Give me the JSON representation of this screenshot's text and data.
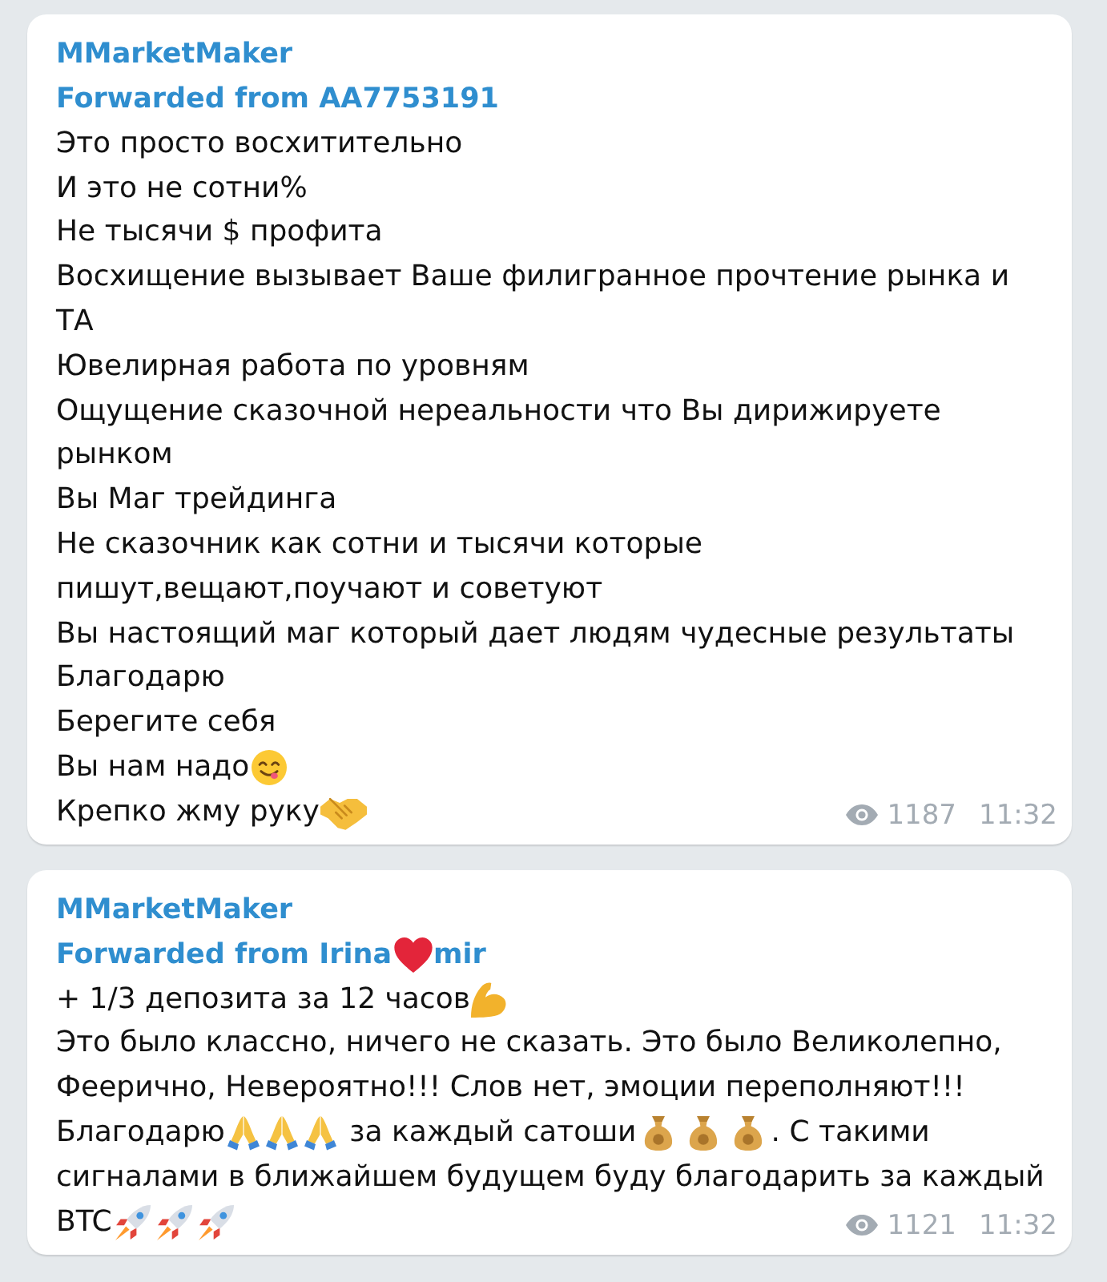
{
  "messages": [
    {
      "author": "MMarketMaker",
      "forwarded": [
        {
          "kind": "text",
          "text": "Forwarded from AA7753191"
        }
      ],
      "lines": [
        {
          "parts": [
            {
              "kind": "text",
              "text": "Это просто восхитительно"
            }
          ]
        },
        {
          "parts": [
            {
              "kind": "text",
              "text": "И это не сотни%"
            }
          ]
        },
        {
          "parts": [
            {
              "kind": "text",
              "text": "Не тысячи $ профита"
            }
          ]
        },
        {
          "parts": [
            {
              "kind": "text",
              "text": "Восхищение вызывает Ваше филигранное прочтение рынка и"
            }
          ]
        },
        {
          "parts": [
            {
              "kind": "text",
              "text": "ТА"
            }
          ]
        },
        {
          "parts": [
            {
              "kind": "text",
              "text": "Ювелирная работа по уровням"
            }
          ]
        },
        {
          "parts": [
            {
              "kind": "text",
              "text": "Ощущение сказочной нереальности что Вы дирижируете"
            }
          ]
        },
        {
          "parts": [
            {
              "kind": "text",
              "text": "рынком"
            }
          ]
        },
        {
          "parts": [
            {
              "kind": "text",
              "text": "Вы Маг трейдинга"
            }
          ]
        },
        {
          "parts": [
            {
              "kind": "text",
              "text": "Не сказочник как сотни и тысячи которые"
            }
          ]
        },
        {
          "parts": [
            {
              "kind": "text",
              "text": "пишут,вещают,поучают и советуют"
            }
          ]
        },
        {
          "parts": [
            {
              "kind": "text",
              "text": "Вы настоящий маг который дает людям чудесные результаты"
            }
          ]
        },
        {
          "parts": [
            {
              "kind": "text",
              "text": "Благодарю"
            }
          ]
        },
        {
          "parts": [
            {
              "kind": "text",
              "text": "Берегите себя"
            }
          ]
        },
        {
          "parts": [
            {
              "kind": "text",
              "text": "Вы нам надо"
            },
            {
              "kind": "yum"
            }
          ]
        },
        {
          "parts": [
            {
              "kind": "text",
              "text": "Крепко жму руку"
            },
            {
              "kind": "handshake"
            }
          ]
        }
      ],
      "views": "1187",
      "time": "11:32"
    },
    {
      "author": "MMarketMaker",
      "forwarded": [
        {
          "kind": "text",
          "text": "Forwarded from Irina"
        },
        {
          "kind": "heart"
        },
        {
          "kind": "text",
          "text": "mir"
        }
      ],
      "lines": [
        {
          "parts": [
            {
              "kind": "text",
              "text": "+ 1/3 депозита за 12 часов"
            },
            {
              "kind": "flex"
            }
          ]
        },
        {
          "parts": [
            {
              "kind": "text",
              "text": "Это было классно, ничего не сказать. Это было Великолепно,"
            }
          ]
        },
        {
          "parts": [
            {
              "kind": "text",
              "text": "Феерично, Невероятно!!! Слов нет, эмоции переполняют!!!"
            }
          ]
        },
        {
          "parts": [
            {
              "kind": "text",
              "text": "Благодарю"
            },
            {
              "kind": "pray"
            },
            {
              "kind": "pray"
            },
            {
              "kind": "pray"
            },
            {
              "kind": "text",
              "text": " за каждый сатоши"
            },
            {
              "kind": "moneybag"
            },
            {
              "kind": "moneybag"
            },
            {
              "kind": "moneybag"
            },
            {
              "kind": "text",
              "text": ". С такими"
            }
          ]
        },
        {
          "parts": [
            {
              "kind": "text",
              "text": "сигналами в ближайшем будущем буду благодарить за каждый"
            }
          ]
        },
        {
          "parts": [
            {
              "kind": "text",
              "text": "BTC"
            },
            {
              "kind": "rocket"
            },
            {
              "kind": "rocket"
            },
            {
              "kind": "rocket"
            }
          ]
        }
      ],
      "views": "1121",
      "time": "11:32"
    }
  ]
}
